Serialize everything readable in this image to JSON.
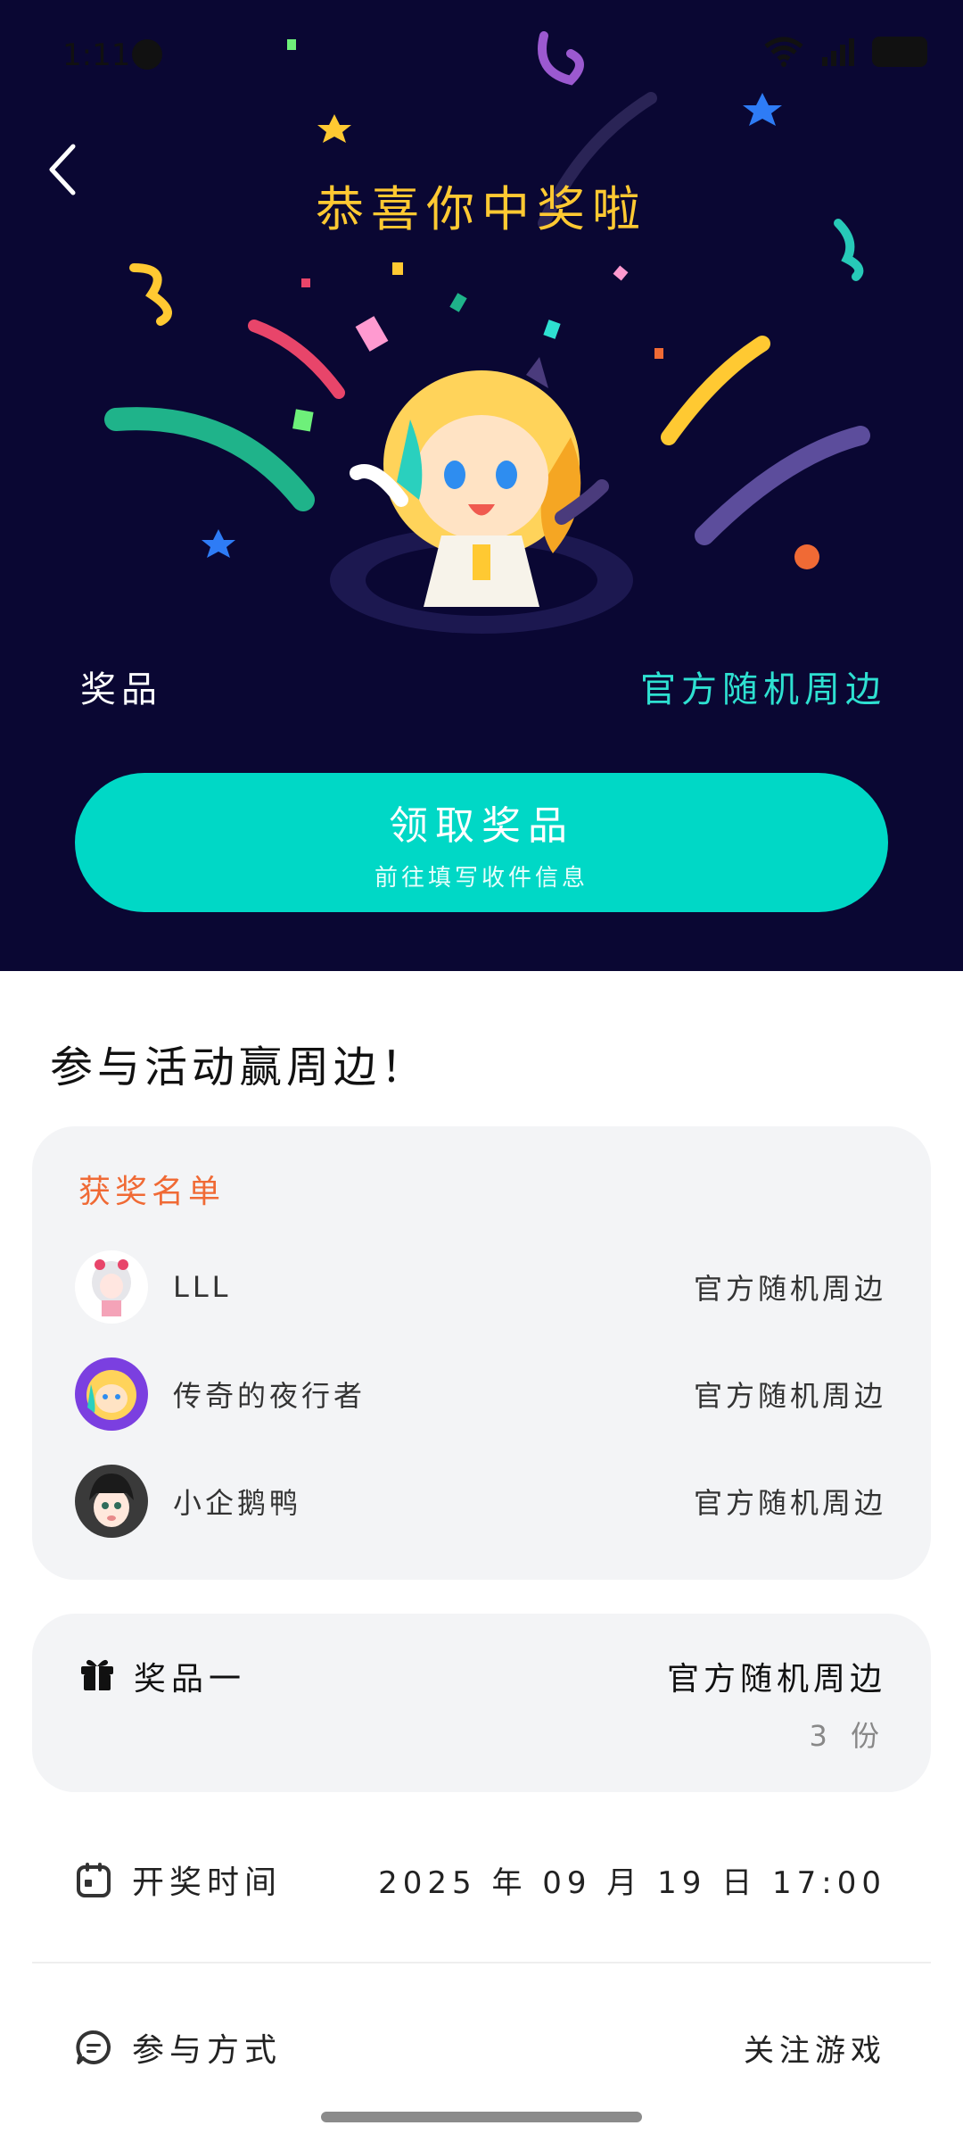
{
  "status_bar": {
    "time": "1:11"
  },
  "hero": {
    "title": "恭喜你中奖啦",
    "prize_label": "奖品",
    "prize_value": "官方随机周边",
    "claim_button": {
      "label": "领取奖品",
      "sublabel": "前往填写收件信息"
    },
    "colors": {
      "background": "#0a0733",
      "title": "#ffc932",
      "accent": "#00d8c6"
    }
  },
  "section_title": "参与活动赢周边！",
  "winners": {
    "title": "获奖名单",
    "rows": [
      {
        "name": "LLL",
        "prize": "官方随机周边",
        "avatar_icon": "anime-girl-avatar"
      },
      {
        "name": "传奇的夜行者",
        "prize": "官方随机周边",
        "avatar_icon": "mascot-avatar"
      },
      {
        "name": "小企鹅鸭",
        "prize": "官方随机周边",
        "avatar_icon": "dark-hair-avatar"
      }
    ]
  },
  "prize_card": {
    "name": "奖品一",
    "value": "官方随机周边",
    "count": "3 份",
    "icon": "gift-icon"
  },
  "draw_time": {
    "label": "开奖时间",
    "value": "2025 年 09 月 19 日 17:00",
    "icon": "calendar-icon"
  },
  "participation": {
    "label": "参与方式",
    "value": "关注游戏",
    "icon": "chat-icon"
  }
}
